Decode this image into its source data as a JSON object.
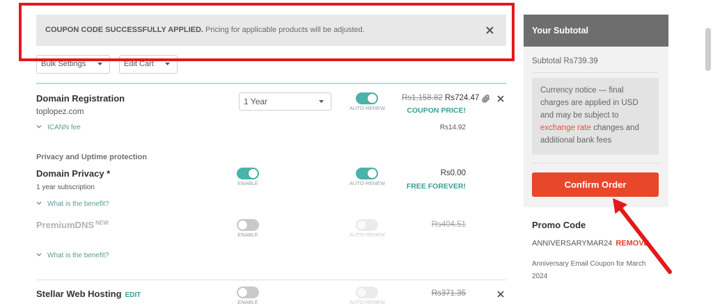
{
  "colors": {
    "teal": "#4ab3aa",
    "teal_text": "#3a9e96",
    "confirm_button": "#e8472b",
    "link_red": "#e5533a",
    "annotation_red": "#e3191b",
    "sidebar_header": "#6e6e6e"
  },
  "icons": {
    "banner_close": "close-icon",
    "dropdown": "chevron-down-icon",
    "expander": "chevron-down-icon",
    "attachment": "paperclip-icon",
    "remove_item": "close-icon"
  },
  "banner": {
    "title": "COUPON CODE SUCCESSFULLY APPLIED.",
    "message": "Pricing for applicable products will be adjusted."
  },
  "toolbar": {
    "bulk_settings": "Bulk Settings",
    "edit_cart": "Edit Cart"
  },
  "cart": {
    "domain_registration": {
      "name": "Domain Registration",
      "domain": "toplopez.com",
      "period": "1 Year",
      "auto_renew": {
        "label": "AUTO-RENEW",
        "on": true,
        "disabled": false
      },
      "old_price": "Rs1,158.82",
      "price": "Rs724.47",
      "price_note": "COUPON PRICE!",
      "fee_label": "ICANN fee",
      "fee_price": "Rs14.92"
    },
    "section_heading": "Privacy and Uptime protection",
    "domain_privacy": {
      "name": "Domain Privacy *",
      "subtitle": "1 year subscription",
      "enable": {
        "label": "ENABLE",
        "on": true,
        "disabled": false
      },
      "auto_renew": {
        "label": "AUTO-RENEW",
        "on": true,
        "disabled": false
      },
      "price": "Rs0.00",
      "price_note": "FREE FOREVER!",
      "benefit_link": "What is the benefit?"
    },
    "premium_dns": {
      "name": "PremiumDNS",
      "badge": "NEW",
      "enable": {
        "label": "ENABLE",
        "on": false,
        "disabled": false
      },
      "auto_renew": {
        "label": "AUTO-RENEW",
        "on": false,
        "disabled": true
      },
      "old_price": "Rs404.51",
      "benefit_link": "What is the benefit?"
    },
    "web_hosting": {
      "name": "Stellar Web Hosting",
      "edit": "EDIT",
      "enable": {
        "label": "ENABLE",
        "on": false,
        "disabled": false
      },
      "auto_renew": {
        "label": "AUTO-RENEW",
        "on": false,
        "disabled": true
      },
      "old_price": "Rs371.35"
    }
  },
  "sidebar": {
    "title": "Your Subtotal",
    "subtotal_label": "Subtotal",
    "subtotal_value": "Rs739.39",
    "notice": {
      "before": "Currency notice — final charges are applied in USD and may be subject to",
      "link": "exchange rate",
      "after": "changes and additional bank fees"
    },
    "confirm_button": "Confirm Order"
  },
  "promo": {
    "heading": "Promo Code",
    "code": "ANNIVERSARYMAR24",
    "remove": "REMOVE",
    "description": "Anniversary Email Coupon for March 2024"
  }
}
